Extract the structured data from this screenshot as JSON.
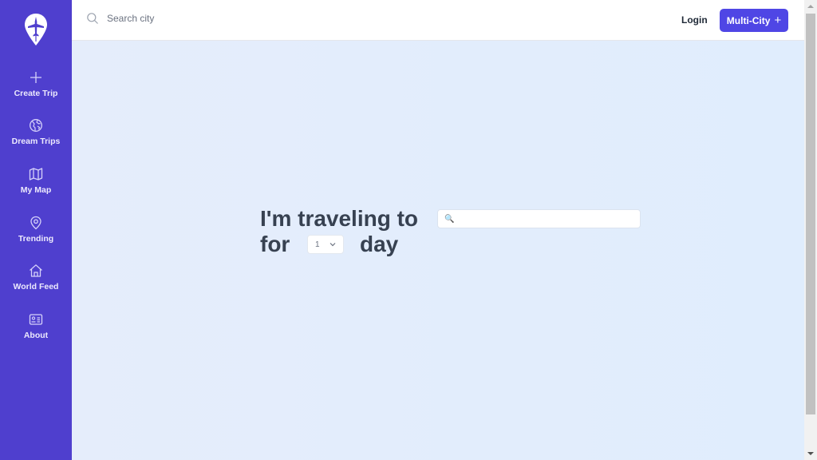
{
  "sidebar": {
    "logo": "plane-pin-logo",
    "items": [
      {
        "label": "Create Trip",
        "icon": "plus-icon"
      },
      {
        "label": "Dream Trips",
        "icon": "globe-icon"
      },
      {
        "label": "My Map",
        "icon": "map-icon"
      },
      {
        "label": "Trending",
        "icon": "map-pin-icon"
      },
      {
        "label": "World Feed",
        "icon": "home-icon"
      },
      {
        "label": "About",
        "icon": "id-card-icon"
      }
    ]
  },
  "topbar": {
    "search_placeholder": "Search city",
    "search_value": "",
    "login_label": "Login",
    "multi_city_label": "Multi-City",
    "multi_city_icon": "+"
  },
  "hero": {
    "line1": "I'm traveling to",
    "line2_prefix": "for",
    "line2_suffix": "day",
    "destination_value": "",
    "destination_icon": "🔍",
    "days_selected": "1"
  },
  "colors": {
    "sidebar_bg": "#4f3fce",
    "accent": "#4f46e5",
    "main_bg": "#e2edfd",
    "heading_text": "#374151"
  }
}
